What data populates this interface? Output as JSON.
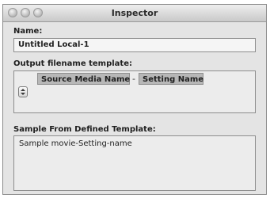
{
  "window": {
    "title": "Inspector"
  },
  "name": {
    "label": "Name:",
    "value": "Untitled Local-1"
  },
  "template": {
    "label": "Output filename template:",
    "tokens": [
      "Source Media Name",
      "Setting Name"
    ],
    "separator": "-"
  },
  "sample": {
    "label": "Sample From Defined Template:",
    "value": "Sample movie-Setting-name"
  }
}
